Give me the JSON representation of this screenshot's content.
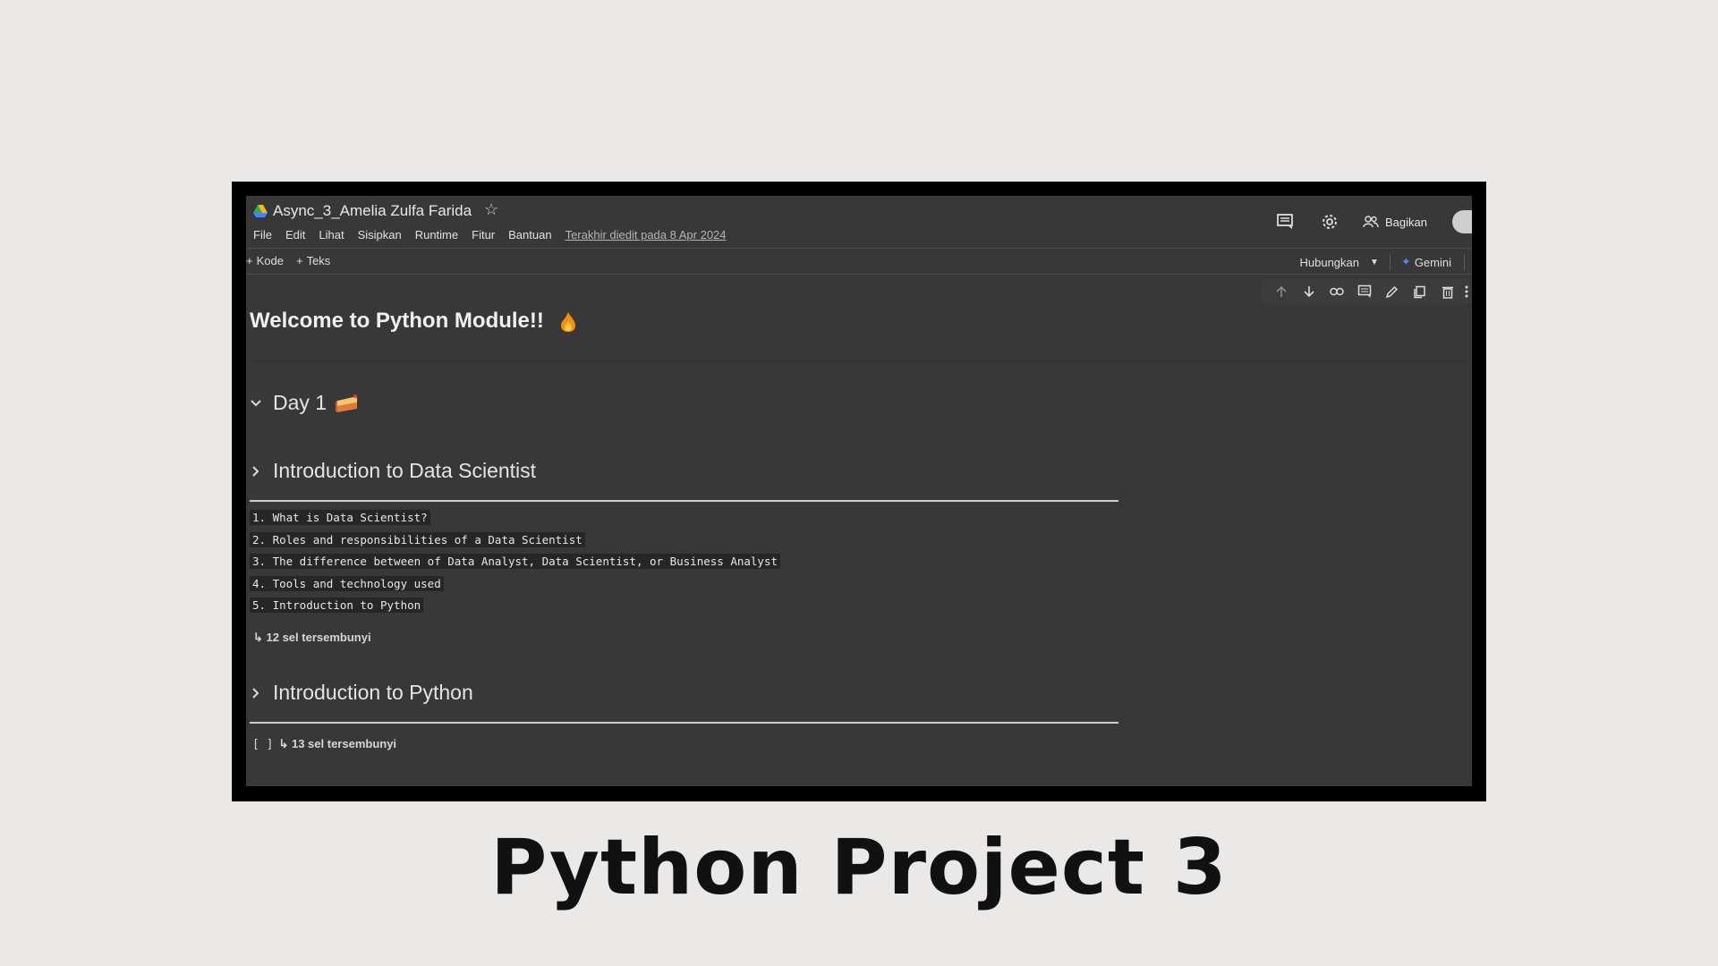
{
  "colab": {
    "doc_title": "Async_3_Amelia Zulfa Farida",
    "menu": [
      "File",
      "Edit",
      "Lihat",
      "Sisipkan",
      "Runtime",
      "Fitur",
      "Bantuan"
    ],
    "last_edited": "Terakhir diedit pada 8 Apr 2024",
    "share_label": "Bagikan",
    "toolbar": {
      "code_label": "Kode",
      "text_label": "Teks",
      "connect_label": "Hubungkan",
      "gemini_label": "Gemini"
    },
    "cell_toolbar_icons": [
      "arrow-up-icon",
      "arrow-down-icon",
      "link-icon",
      "comment-icon",
      "pencil-icon",
      "copy-icon",
      "trash-icon",
      "more-vert-icon"
    ]
  },
  "notebook": {
    "heading": "Welcome to Python Module!!",
    "day1": {
      "title": "Day 1"
    },
    "intro_ds": {
      "title": "Introduction to Data Scientist",
      "items": [
        "1. What is Data Scientist?",
        "2. Roles and responsibilities of a Data Scientist",
        "3. The difference between of Data Analyst, Data Scientist, or Business Analyst",
        "4. Tools and technology used",
        "5. Introduction to Python"
      ],
      "hidden_cells": "↳ 12 sel tersembunyi"
    },
    "intro_py": {
      "title": "Introduction to Python",
      "bracket": "[ ]",
      "hidden_cells": "↳ 13 sel tersembunyi"
    }
  },
  "slide_title": "Python Project 3"
}
